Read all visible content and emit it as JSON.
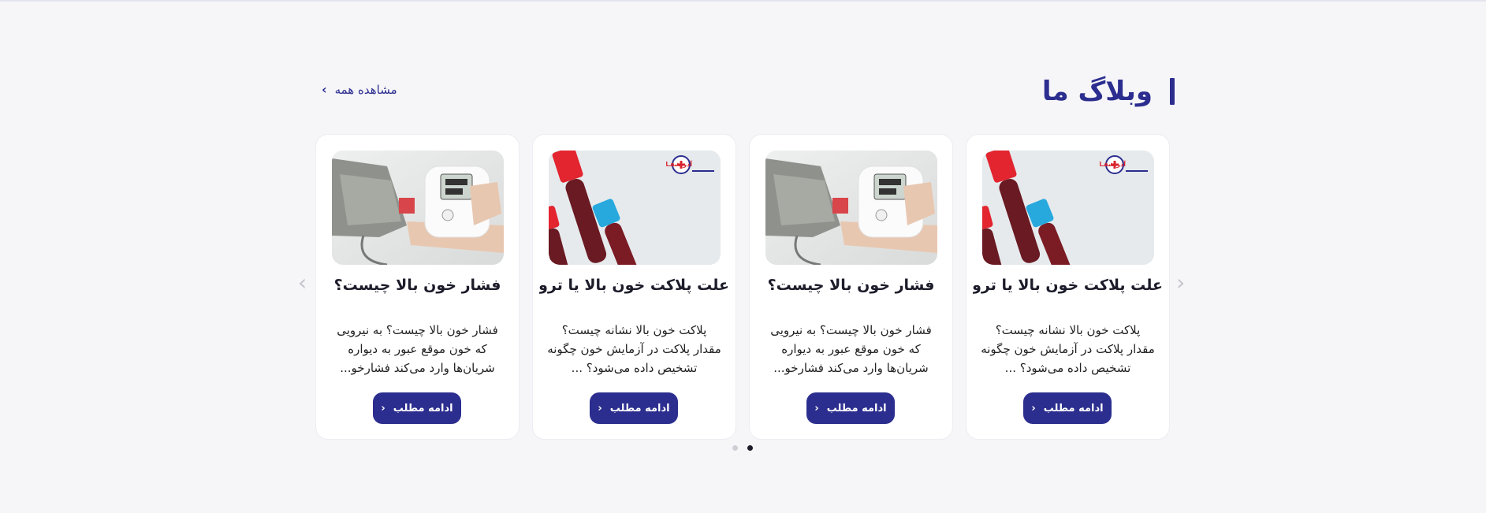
{
  "section": {
    "title": "وبلاگ ما",
    "see_all_label": "مشاهده همه",
    "see_all_icon": "chevron-left-icon"
  },
  "cards": [
    {
      "image": "blood-pressure-monitor-image",
      "title": "فشار خون بالا چیست؟",
      "excerpt": "فشار خون بالا چیست؟ به نیرویی که خون موقع عبور به دیواره شریان‌ها وارد می‌کند فشارخو...",
      "button_label": "ادامه مطلب"
    },
    {
      "image": "blood-test-tubes-image",
      "title": "علت پلاکت خون بالا یا ترومـ...",
      "excerpt": "پلاکت خون بالا نشانه چیست؟ مقدار پلاکت در آزمایش خون چگونه تشخیص داده می‌شود؟ ...",
      "button_label": "ادامه مطلب",
      "logo_text": "آذر شفـا"
    },
    {
      "image": "blood-pressure-monitor-image",
      "title": "فشار خون بالا چیست؟",
      "excerpt": "فشار خون بالا چیست؟ به نیرویی که خون موقع عبور به دیواره شریان‌ها وارد می‌کند فشارخو...",
      "button_label": "ادامه مطلب"
    },
    {
      "image": "blood-test-tubes-image",
      "title": "علت پلاکت خون بالا یا ترومـ...",
      "excerpt": "پلاکت خون بالا نشانه چیست؟ مقدار پلاکت در آزمایش خون چگونه تشخیص داده می‌شود؟ ...",
      "button_label": "ادامه مطلب",
      "logo_text": "آذر شفـا"
    }
  ],
  "navigation": {
    "prev_icon": "chevron-left-icon",
    "next_icon": "chevron-right-icon",
    "prev_glyph": "‹",
    "next_glyph": "›",
    "chevron_glyph": "‹",
    "page_count": 2,
    "active_page": 2
  },
  "colors": {
    "primary": "#2c2e8f",
    "background": "#f6f6f9",
    "card": "#ffffff"
  }
}
